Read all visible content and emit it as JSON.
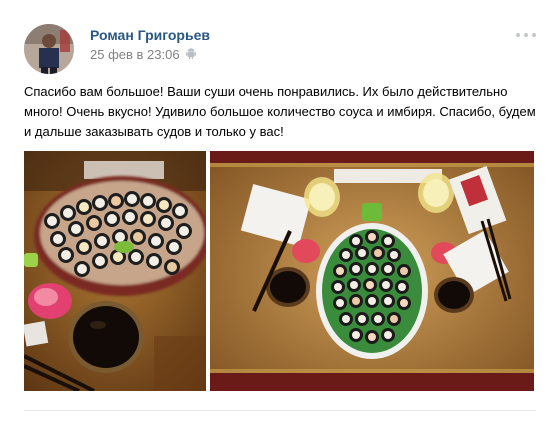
{
  "post": {
    "author": "Роман Григорьев",
    "date": "25 фев в 23:06",
    "text": "Спасибо вам большое! Ваши суши очень понравились. Их было действительно много! Очень вкусно! Удивило большое количество соуса и имбиря. Спасибо, будем и дальше заказывать судов и только у вас!",
    "source_icon": "android-icon",
    "more_icon": "more-dots-icon"
  },
  "photos": [
    {
      "name": "sushi-photo-1"
    },
    {
      "name": "sushi-photo-2"
    }
  ],
  "colors": {
    "author_link": "#2a5885",
    "meta_gray": "#828282"
  }
}
